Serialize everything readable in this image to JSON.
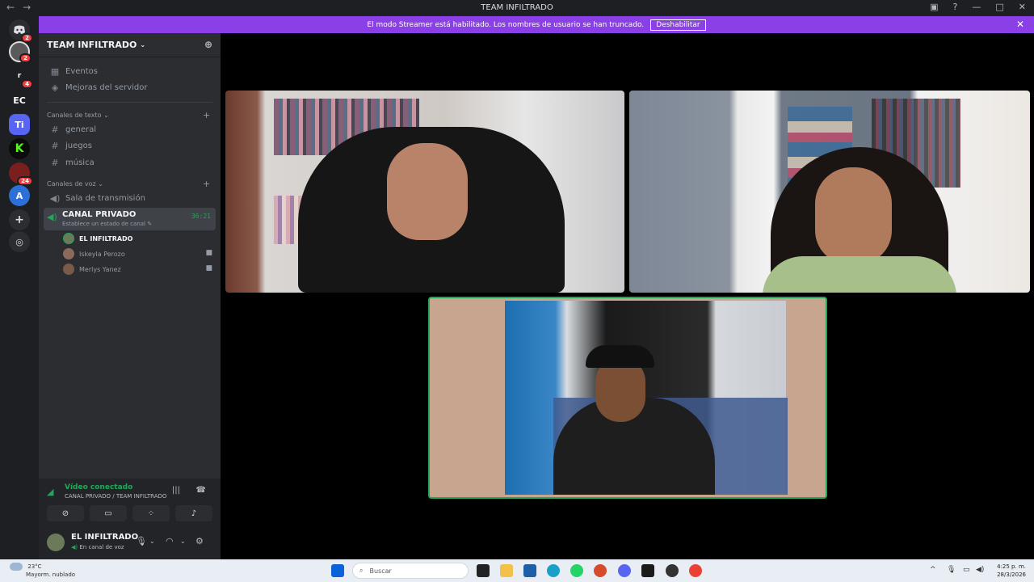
{
  "window": {
    "title": "TEAM INFILTRADO",
    "back": "←",
    "forward": "→"
  },
  "banner": {
    "message": "El modo Streamer está habilitado. Los nombres de usuario se han truncado.",
    "button": "Deshabilitar"
  },
  "guilds": {
    "items": [
      {
        "label": "",
        "badge": "2"
      },
      {
        "label": "",
        "badge": "2"
      },
      {
        "label": "r",
        "badge": "4"
      },
      {
        "label": "EC",
        "badge": ""
      },
      {
        "label": "Ti",
        "badge": ""
      },
      {
        "label": "K",
        "badge": ""
      },
      {
        "label": "",
        "badge": "24"
      },
      {
        "label": "A",
        "badge": ""
      }
    ]
  },
  "server": {
    "name": "TEAM INFILTRADO"
  },
  "sidebar": {
    "events": "Eventos",
    "boosts": "Mejoras del servidor",
    "text_category": "Canales de texto",
    "text_channels": [
      "general",
      "juegos",
      "música"
    ],
    "voice_category": "Canales de voz",
    "stage_channel": "Sala de transmisión",
    "active_channel": {
      "name": "CANAL PRIVADO",
      "status": "Establece un estado de canal",
      "timer": "36:21"
    },
    "voice_users": [
      {
        "name": "EL INFILTRADO",
        "camera": false
      },
      {
        "name": "Iskeyla Perozo",
        "camera": true
      },
      {
        "name": "Merlys Yanez",
        "camera": true
      }
    ]
  },
  "voice_panel": {
    "status": "Vídeo conectado",
    "channel": "CANAL PRIVADO / TEAM INFILTRADO"
  },
  "user_panel": {
    "username": "EL INFILTRADO",
    "status": "En canal de voz"
  },
  "taskbar": {
    "weather_temp": "23°C",
    "weather_desc": "Mayorm. nublado",
    "search_placeholder": "Buscar",
    "time": "4:25 p. m.",
    "date": "28/3/2026"
  }
}
